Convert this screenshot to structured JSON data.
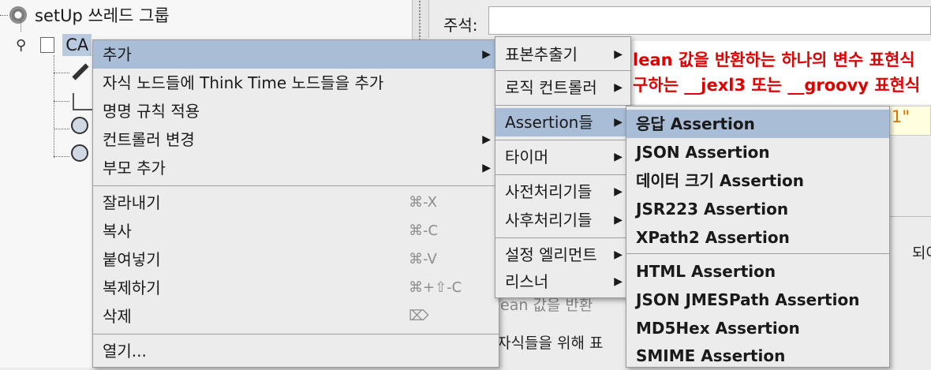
{
  "tree": {
    "root_label": "setUp 쓰레드 그룹",
    "child_label": "CA"
  },
  "editor": {
    "comment_label": "주석:",
    "red_line1": "lean 값을 반환하는 하나의 변수 표현식",
    "red_line2": "구하는 __jexl3 또는 __groovy 표현식",
    "quote_text": "1\"",
    "peek_right": "되어있음",
    "peek_mid1": "ean 값을 반환",
    "peek_mid2": "자식들을 위해 표"
  },
  "context_menu": {
    "items": [
      {
        "label": "추가"
      },
      {
        "label": "자식 노드들에 Think Time 노드들을 추가"
      },
      {
        "label": "명명 규칙 적용"
      },
      {
        "label": "컨트롤러 변경"
      },
      {
        "label": "부모 추가"
      },
      {
        "label": "잘라내기",
        "shortcut": "⌘-X"
      },
      {
        "label": "복사",
        "shortcut": "⌘-C"
      },
      {
        "label": "붙여넣기",
        "shortcut": "⌘-V"
      },
      {
        "label": "복제하기",
        "shortcut": "⌘+⇧-C"
      },
      {
        "label": "삭제",
        "shortcut": "⌦"
      },
      {
        "label": "열기..."
      }
    ]
  },
  "add_submenu": {
    "items": [
      {
        "label": "표본추출기"
      },
      {
        "label": "로직 컨트롤러"
      },
      {
        "label": "Assertion들"
      },
      {
        "label": "타이머"
      },
      {
        "label": "사전처리기들"
      },
      {
        "label": "사후처리기들"
      },
      {
        "label": "설정 엘리먼트"
      },
      {
        "label": "리스너"
      }
    ]
  },
  "assertion_submenu": {
    "items": [
      {
        "label": "응답 Assertion"
      },
      {
        "label": "JSON Assertion"
      },
      {
        "label": "데이터 크기 Assertion"
      },
      {
        "label": "JSR223 Assertion"
      },
      {
        "label": "XPath2 Assertion"
      },
      {
        "label": "HTML Assertion"
      },
      {
        "label": "JSON JMESPath Assertion"
      },
      {
        "label": "MD5Hex Assertion"
      },
      {
        "label": "SMIME Assertion"
      }
    ]
  },
  "colors": {
    "selection": "#a9bdd6",
    "menu_bg": "#ececec",
    "red": "#e00000"
  }
}
